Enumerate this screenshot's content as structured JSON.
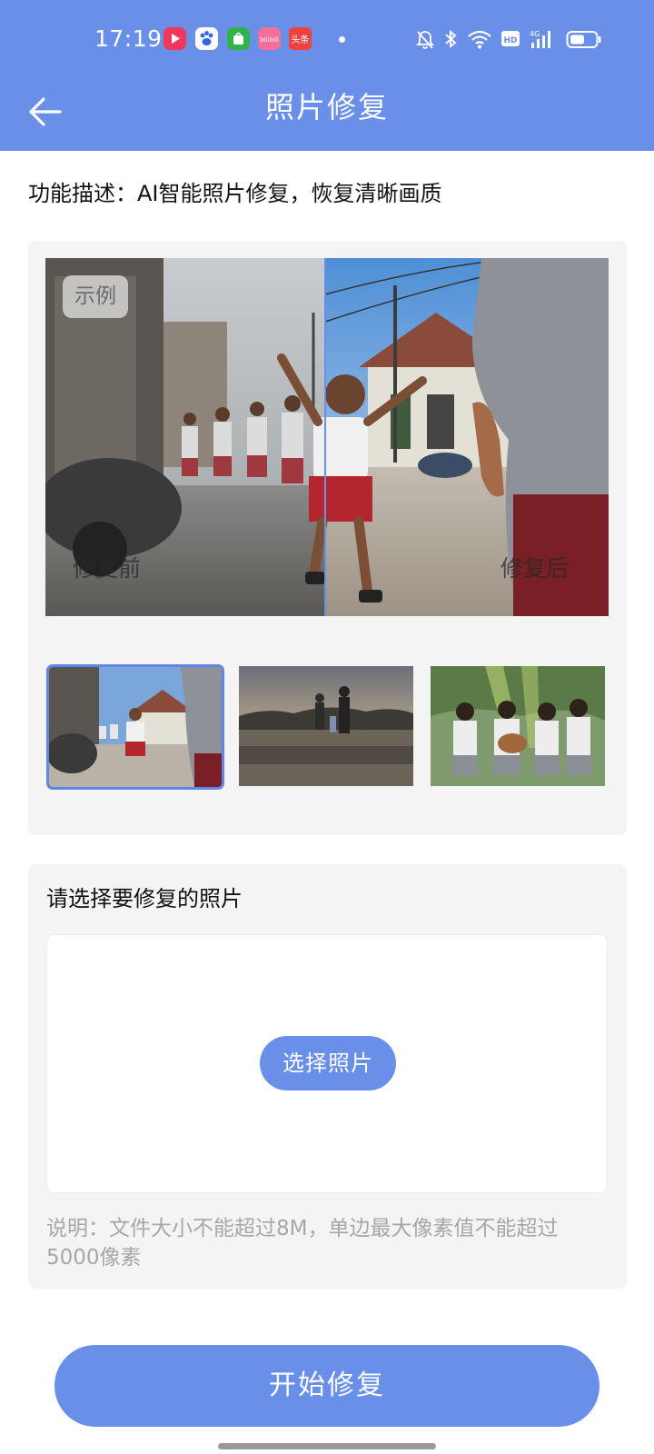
{
  "status_bar": {
    "time": "17:19",
    "notification_apps": [
      "video-app-icon",
      "baidu-paw-icon",
      "taobao-bag-icon",
      "bilibili-icon",
      "toutiao-icon"
    ],
    "toutiao_label": "头条",
    "bilibili_label": "bilibili",
    "system_icons": [
      "mute-bell-icon",
      "bluetooth-icon",
      "wifi-icon",
      "hd-icon",
      "signal-4g-icon",
      "battery-icon"
    ],
    "hd_label": "HD",
    "network_label": "4G"
  },
  "app_bar": {
    "title": "照片修复",
    "back_icon": "arrow-left-icon"
  },
  "feature_description": "功能描述：AI智能照片修复，恢复清晰画质",
  "example": {
    "badge": "示例",
    "before_label": "修复前",
    "after_label": "修复后",
    "thumbnails": [
      {
        "subject": "children-running-street-photo",
        "selected": true
      },
      {
        "subject": "family-walking-field-photo",
        "selected": false
      },
      {
        "subject": "girls-with-guitar-photo",
        "selected": false
      }
    ]
  },
  "upload": {
    "title": "请选择要修复的照片",
    "choose_button": "选择照片",
    "note": "说明：文件大小不能超过8M，单边最大像素值不能超过5000像素"
  },
  "start_button": "开始修复",
  "colors": {
    "brand": "#6a8fe8",
    "card_bg": "#f4f4f4",
    "note_text": "#a7a7a7"
  }
}
